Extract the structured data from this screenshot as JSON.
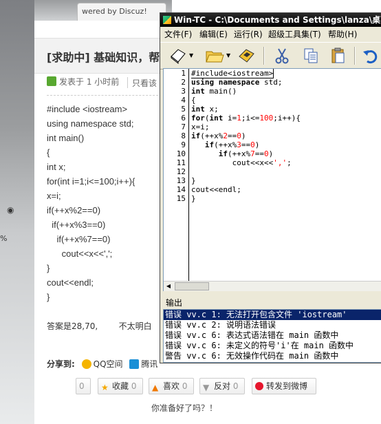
{
  "forum": {
    "tab_label": "wered by Discuz!",
    "title": "[求助中] 基础知识，帮",
    "posted": "发表于 1 小时前",
    "only_author": "只看该",
    "code_lines": [
      "#include <iostream>",
      "using namespace std;",
      "int main()",
      "{",
      "int x;",
      "for(int i=1;i<=100;i++){",
      "x=i;",
      "if(++x%2==0)",
      "  if(++x%3==0)",
      "    if(++x%7==0)",
      "      cout<<x<<',';",
      "}",
      "cout<<endl;",
      "}"
    ],
    "answer": "答案是28,70,        不太明白",
    "share_label": "分享到:",
    "share_qzone": "QQ空间",
    "share_tencent": "腾讯",
    "btn_first_count": "0",
    "btn_favorite": "收藏",
    "btn_favorite_count": "0",
    "btn_like": "喜欢",
    "btn_like_count": "0",
    "btn_oppose": "反对",
    "btn_oppose_count": "0",
    "btn_weibo": "转发到微博",
    "question": "你准备好了吗？！",
    "side_percent": "%"
  },
  "wintc": {
    "title": "Win-TC - C:\\Documents and Settings\\lanza\\桌面\\v",
    "menu": [
      "文件(F)",
      "编辑(E)",
      "运行(R)",
      "超级工具集(T)",
      "帮助(H)"
    ],
    "line_numbers": [
      "1",
      "2",
      "3",
      "4",
      "5",
      "6",
      "7",
      "8",
      "9",
      "10",
      "11",
      "12",
      "13",
      "14",
      "15"
    ],
    "code": [
      "#include<iostream>",
      "using namespace std;",
      "int main()",
      "{",
      "int x;",
      "for(int i=1;i<=100;i++){",
      "x=i;",
      "if(++x%2==0)",
      "   if(++x%3==0)",
      "      if(++x%7==0)",
      "         cout<<x<<',';",
      "",
      "}",
      "cout<<endl;",
      "}"
    ],
    "output_label": "输出",
    "output_lines": [
      "错误 vv.c 1: 无法打开包含文件 'iostream'",
      "错误 vv.c 2: 说明语法错误",
      "错误 vv.c 6: 表达式语法错在 main 函数中",
      "错误 vv.c 6: 未定义的符号'i'在 main 函数中",
      "警告 vv.c 6: 无效操作代码在 main 函数中"
    ],
    "icons": [
      "new-file-icon",
      "open-folder-icon",
      "save-disk-icon",
      "cut-icon",
      "copy-icon",
      "paste-icon",
      "undo-icon"
    ]
  },
  "colors": {
    "selection": "#0a246a",
    "number": "#ff0000",
    "window_bg": "#ece9d8"
  }
}
